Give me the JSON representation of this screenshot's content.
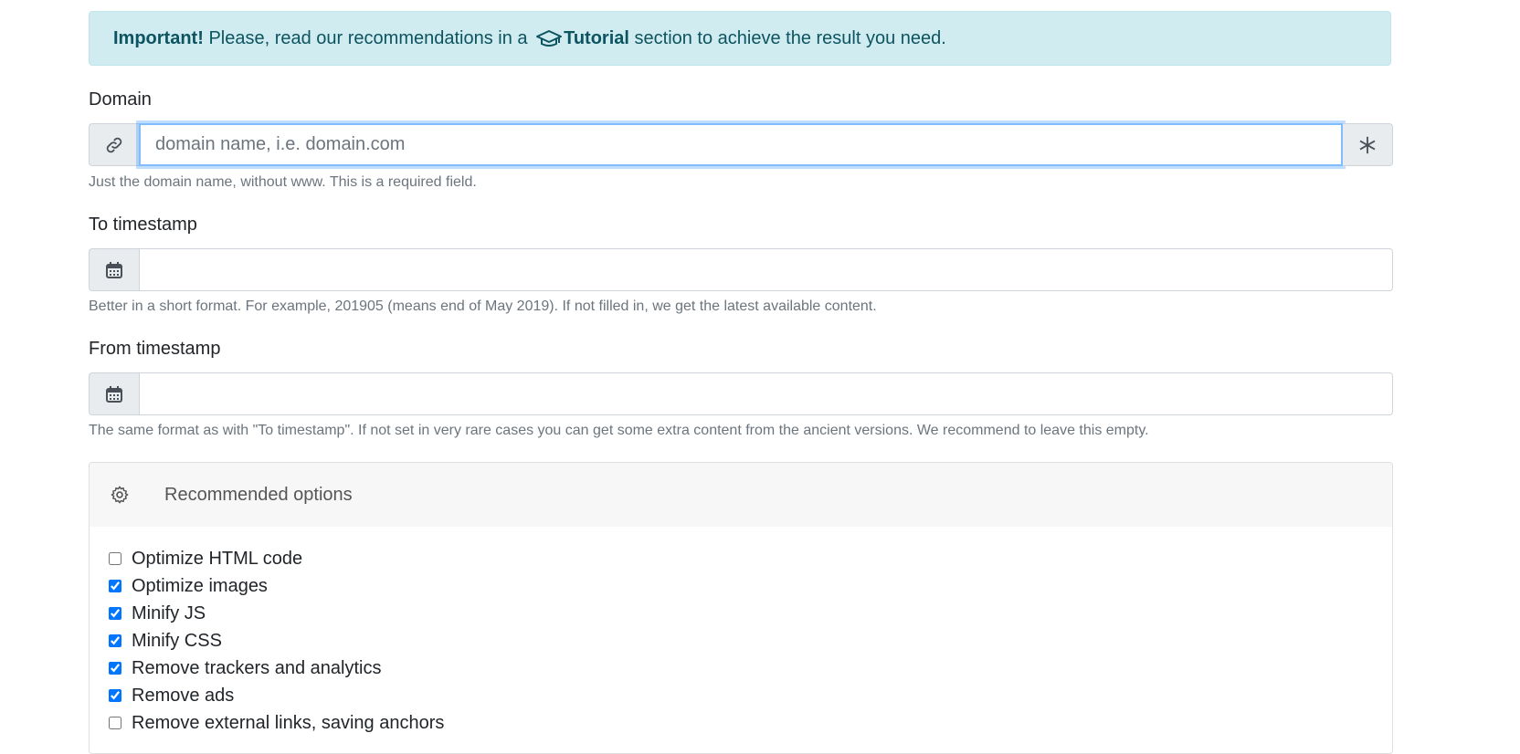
{
  "alert": {
    "strong": "Important!",
    "text_before": " Please, read our recommendations in a ",
    "link": "Tutorial",
    "text_after": " section to achieve the result you need."
  },
  "domain": {
    "label": "Domain",
    "value": "",
    "placeholder": "domain name, i.e. domain.com",
    "help": "Just the domain name, without www. This is a required field.",
    "left_icon": "link-icon",
    "right_icon": "asterisk-icon"
  },
  "to_timestamp": {
    "label": "To timestamp",
    "value": "",
    "help": "Better in a short format. For example, 201905 (means end of May 2019). If not filled in, we get the latest available content.",
    "icon": "calendar-icon"
  },
  "from_timestamp": {
    "label": "From timestamp",
    "value": "",
    "help": "The same format as with \"To timestamp\". If not set in very rare cases you can get some extra content from the ancient versions. We recommend to leave this empty.",
    "icon": "calendar-icon"
  },
  "options": {
    "title": "Recommended options",
    "icon": "gear-icon",
    "items": [
      {
        "label": "Optimize HTML code",
        "checked": false
      },
      {
        "label": "Optimize images",
        "checked": true
      },
      {
        "label": "Minify JS",
        "checked": true
      },
      {
        "label": "Minify CSS",
        "checked": true
      },
      {
        "label": "Remove trackers and analytics",
        "checked": true
      },
      {
        "label": "Remove ads",
        "checked": true
      },
      {
        "label": "Remove external links, saving anchors",
        "checked": false
      }
    ]
  }
}
